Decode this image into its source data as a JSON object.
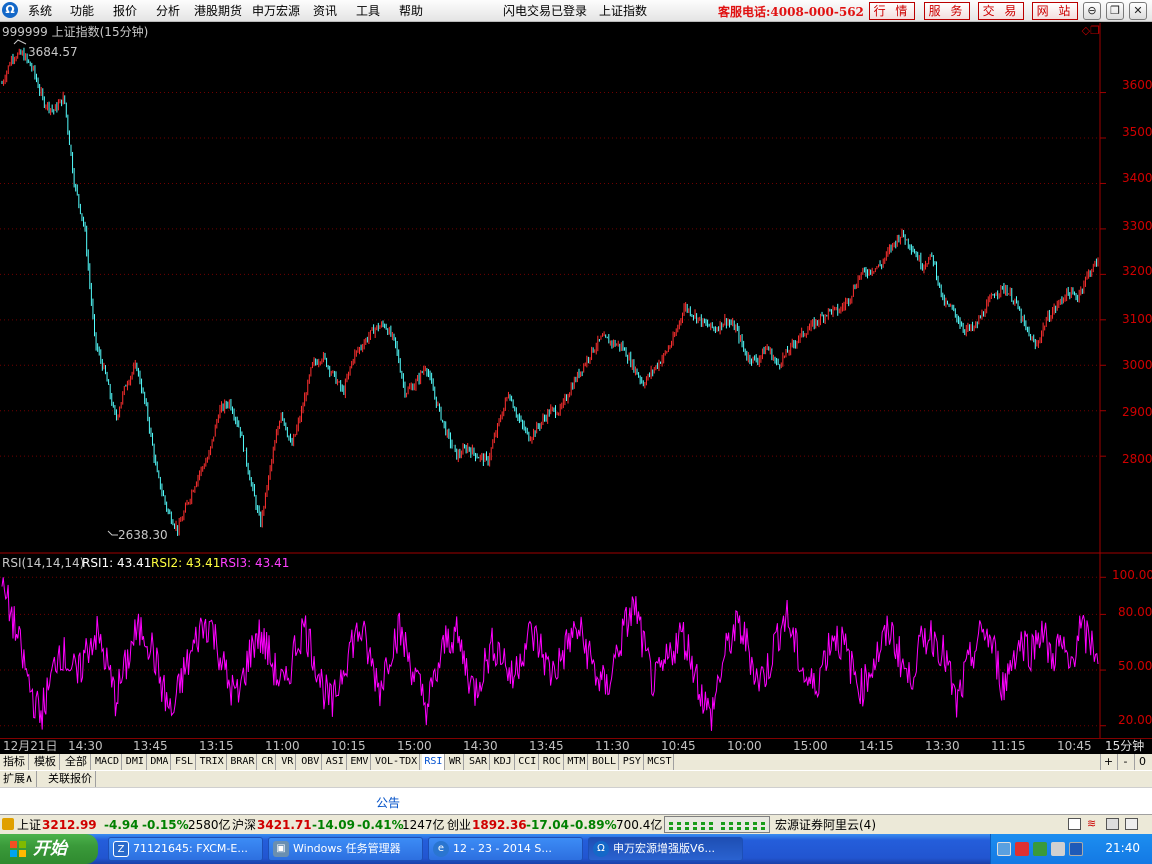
{
  "menu": {
    "items": [
      "系统",
      "功能",
      "报价",
      "分析",
      "港股期货",
      "申万宏源",
      "资讯",
      "工具",
      "帮助"
    ],
    "login_status": "闪电交易已登录",
    "current_index": "上证指数",
    "hotline": "客服电话:4008-000-562",
    "buttons": [
      "行 情",
      "服 务",
      "交 易",
      "网 站"
    ]
  },
  "chart": {
    "title": "999999 上证指数(15分钟)",
    "high_label": "3684.57",
    "low_label": "2638.30",
    "rsi_title": "RSI(14,14,14)",
    "rsi1": "RSI1: 43.41",
    "rsi2": "RSI2: 43.41",
    "rsi3": "RSI3: 43.41",
    "colors": {
      "up": "#ff3030",
      "down": "#54ffff",
      "rsi": "#ff00ff",
      "axis": "#a00000"
    }
  },
  "chart_data": {
    "type": "line",
    "y_ticks": [
      2800,
      2900,
      3000,
      3100,
      3200,
      3300,
      3400,
      3500,
      3600
    ],
    "ylim": [
      2620,
      3720
    ],
    "series": [
      {
        "values": [
          3620,
          3680,
          3684.57,
          3650,
          3580,
          3560,
          3590,
          3400,
          3300,
          3050,
          2980,
          2880,
          2960,
          3000,
          2900,
          2760,
          2680,
          2638.3,
          2700,
          2760,
          2800,
          2900,
          2920,
          2860,
          2750,
          2650,
          2780,
          2900,
          2820,
          2900,
          3000,
          3020,
          2980,
          2940,
          3020,
          3050,
          3080,
          3090,
          3050,
          2940,
          2960,
          3000,
          2920,
          2850,
          2800,
          2820,
          2800,
          2790,
          2870,
          2940,
          2880,
          2840,
          2870,
          2900,
          2900,
          2950,
          2990,
          3030,
          3060,
          3050,
          3040,
          3000,
          2960,
          2990,
          3020,
          3060,
          3130,
          3110,
          3090,
          3080,
          3100,
          3080,
          3020,
          3010,
          3040,
          3000,
          3030,
          3060,
          3080,
          3100,
          3120,
          3120,
          3150,
          3200,
          3210,
          3220,
          3260,
          3290,
          3260,
          3220,
          3240,
          3140,
          3120,
          3080,
          3080,
          3120,
          3160,
          3170,
          3140,
          3080,
          3040,
          3100,
          3130,
          3160,
          3150,
          3200,
          3230
        ]
      }
    ],
    "rsi_ticks": [
      20,
      50,
      80,
      100
    ],
    "rsi_ylim": [
      15,
      105
    ],
    "rsi_series": [
      {
        "name": "RSI3",
        "values": [
          95,
          80,
          60,
          40,
          25,
          40,
          62,
          55,
          45,
          62,
          70,
          55,
          35,
          50,
          68,
          72,
          60,
          40,
          25,
          45,
          58,
          72,
          76,
          60,
          42,
          35,
          55,
          70,
          62,
          48,
          40,
          62,
          74,
          58,
          40,
          30,
          50,
          65,
          72,
          55,
          40,
          60,
          72,
          58,
          42,
          30,
          48,
          66,
          70,
          54,
          38,
          52,
          64,
          58,
          44,
          60,
          70,
          62,
          48,
          54,
          66,
          72,
          60,
          46,
          40,
          58,
          74,
          85,
          60,
          42,
          50,
          62,
          70,
          56,
          38,
          24,
          48,
          66,
          74,
          62,
          44,
          50,
          68,
          80,
          62,
          46,
          40,
          56,
          70,
          64,
          50,
          40,
          52,
          62,
          72,
          58,
          44,
          60,
          70,
          66,
          54,
          30,
          48,
          62,
          72,
          60,
          40,
          58,
          66,
          60,
          74,
          56,
          64,
          50,
          72,
          66,
          60
        ]
      }
    ],
    "x_ticks": [
      "12月21日",
      "14:30",
      "13:45",
      "13:15",
      "11:00",
      "10:15",
      "15:00",
      "14:30",
      "13:45",
      "11:30",
      "10:45",
      "10:00",
      "15:00",
      "14:15",
      "13:30",
      "11:15",
      "10:45"
    ]
  },
  "price_axis_labels": [
    "3600",
    "3500",
    "3400",
    "3300",
    "3200",
    "3100",
    "3000",
    "2900",
    "2800"
  ],
  "rsi_axis_labels": [
    "100.00",
    "80.00",
    "50.00",
    "20.00"
  ],
  "period_label": "15分钟",
  "tabs": {
    "main": [
      "指标",
      "模板",
      "全部"
    ],
    "indicators": [
      "MACD",
      "DMI",
      "DMA",
      "FSL",
      "TRIX",
      "BRAR",
      "CR",
      "VR",
      "OBV",
      "ASI",
      "EMV",
      "VOL-TDX",
      "RSI",
      "WR",
      "SAR",
      "KDJ",
      "CCI",
      "ROC",
      "MTM",
      "BOLL",
      "PSY",
      "MCST"
    ],
    "active_indicator": "RSI",
    "controls": [
      "+",
      "-",
      "0"
    ],
    "sub": [
      "扩展∧",
      "关联报价"
    ]
  },
  "notice": "公告",
  "status": {
    "sh_label": "上证",
    "sh_value": "3212.99",
    "sh_change": "-4.94",
    "sh_pct": "-0.15%",
    "sh_volume": "2580亿",
    "hs_label": "沪深",
    "hs_value": "3421.71",
    "hs_change": "-14.09",
    "hs_pct": "-0.41%",
    "hs_volume": "1247亿",
    "cy_label": "创业",
    "cy_value": "1892.36",
    "cy_change": "-17.04",
    "cy_pct": "-0.89%",
    "cy_volume": "700.4亿",
    "broker": "宏源证券阿里云(4)"
  },
  "taskbar": {
    "start": "开始",
    "tasks": [
      "71121645: FXCM-E...",
      "Windows 任务管理器",
      "12 - 23 - 2014 S...",
      "申万宏源增强版V6..."
    ],
    "clock": "21:40"
  }
}
